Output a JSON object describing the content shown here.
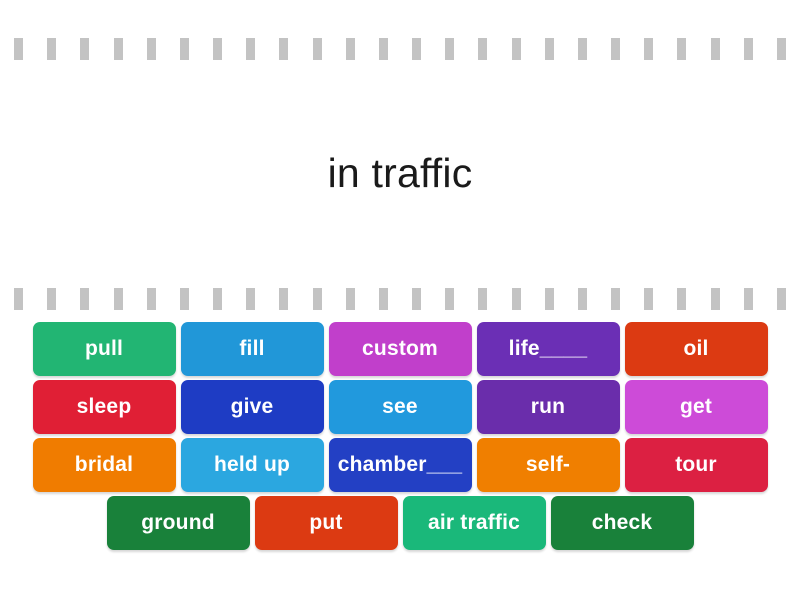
{
  "activity": {
    "prompt": "in traffic",
    "separator_dash_count": 24,
    "separator_color": "#c3c3c3"
  },
  "palette": {
    "emerald": "#22b573",
    "sky": "#2197d8",
    "orchid": "#c13fcb",
    "violet": "#6b2fb5",
    "vermilion": "#dc3a12",
    "crimson": "#e01f35",
    "royal": "#1e3cc4",
    "azure": "#2199dd",
    "grape": "#6a2dab",
    "magenta": "#cd4bd8",
    "orange": "#f07c00",
    "cobalt": "#2340c4",
    "tangerine": "#f07f00",
    "ruby": "#dc2042",
    "forest": "#19813a",
    "jade": "#1ab87a"
  },
  "tile_rows": [
    [
      {
        "label": "pull",
        "color": "#22b573"
      },
      {
        "label": "fill",
        "color": "#2197d8"
      },
      {
        "label": "custom",
        "color": "#c13fcb"
      },
      {
        "label": "life____",
        "color": "#6b2fb5"
      },
      {
        "label": "oil",
        "color": "#dc3a12"
      }
    ],
    [
      {
        "label": "sleep",
        "color": "#e01f35"
      },
      {
        "label": "give",
        "color": "#1e3cc4"
      },
      {
        "label": "see",
        "color": "#2199dd"
      },
      {
        "label": "run",
        "color": "#6a2dab"
      },
      {
        "label": "get",
        "color": "#cd4bd8"
      }
    ],
    [
      {
        "label": "bridal",
        "color": "#f07c00"
      },
      {
        "label": "held up",
        "color": "#2ba7e0"
      },
      {
        "label": "chamber___",
        "color": "#2340c4"
      },
      {
        "label": "self-",
        "color": "#f07f00"
      },
      {
        "label": "tour",
        "color": "#dc2042"
      }
    ],
    [
      {
        "label": "ground",
        "color": "#19813a"
      },
      {
        "label": "put",
        "color": "#dc3a12"
      },
      {
        "label": "air traffic",
        "color": "#1ab87a"
      },
      {
        "label": "check",
        "color": "#19813a"
      }
    ]
  ]
}
